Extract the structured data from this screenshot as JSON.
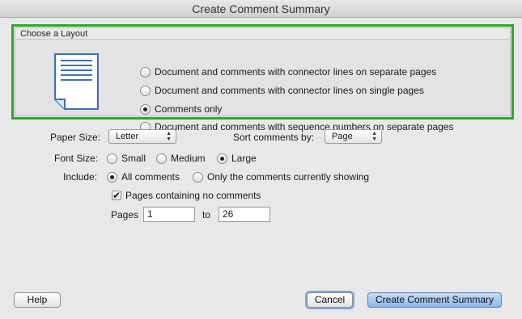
{
  "window": {
    "title": "Create Comment Summary"
  },
  "layout_group": {
    "header": "Choose a Layout",
    "options": [
      {
        "label": "Document and comments with connector lines on separate pages",
        "selected": false
      },
      {
        "label": "Document and comments with connector lines on single pages",
        "selected": false
      },
      {
        "label": "Comments only",
        "selected": true
      },
      {
        "label": "Document and comments with sequence numbers on separate pages",
        "selected": false
      }
    ]
  },
  "paper_size": {
    "label": "Paper Size:",
    "value": "Letter"
  },
  "sort": {
    "label": "Sort comments by:",
    "value": "Page"
  },
  "font_size": {
    "label": "Font Size:",
    "options": [
      {
        "label": "Small",
        "selected": false
      },
      {
        "label": "Medium",
        "selected": false
      },
      {
        "label": "Large",
        "selected": true
      }
    ]
  },
  "include": {
    "label": "Include:",
    "options": [
      {
        "label": "All comments",
        "selected": true
      },
      {
        "label": "Only the comments currently showing",
        "selected": false
      }
    ]
  },
  "pages_no_comments": {
    "label": "Pages containing no comments",
    "checked": true
  },
  "pages_range": {
    "label": "Pages",
    "from": "1",
    "to_label": "to",
    "to": "26"
  },
  "buttons": {
    "help": "Help",
    "cancel": "Cancel",
    "create": "Create Comment Summary"
  },
  "colors": {
    "highlight": "#2ea82e",
    "default_button": "#8fb7ea"
  }
}
